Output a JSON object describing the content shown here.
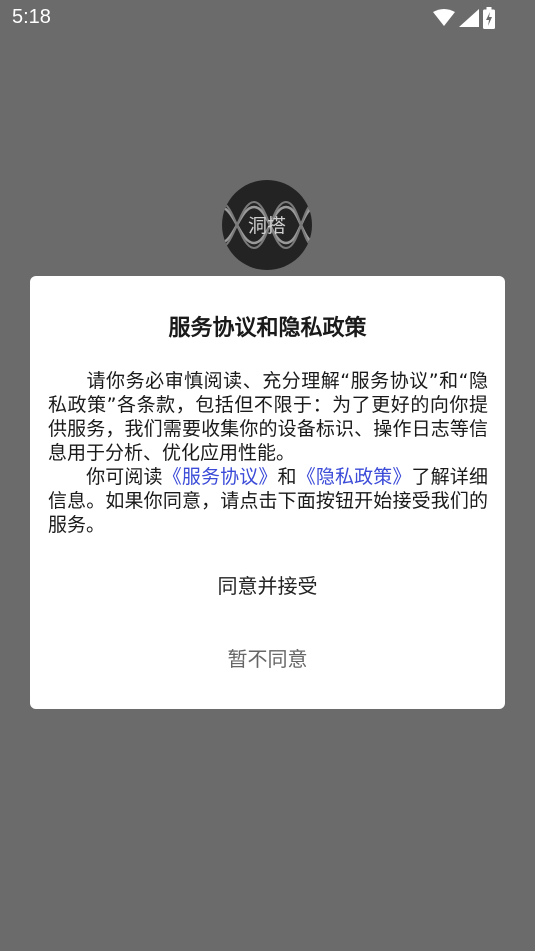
{
  "status_bar": {
    "time": "5:18",
    "icons": [
      "wifi-icon",
      "signal-icon",
      "battery-charging-icon"
    ]
  },
  "logo": {
    "text": "洞搭"
  },
  "dialog": {
    "title": "服务协议和隐私政策",
    "paragraph1": "请你务必审慎阅读、充分理解“服务协议”和“隐私政策”各条款，包括但不限于：为了更好的向你提供服务，我们需要收集你的设备标识、操作日志等信息用于分析、优化应用性能。",
    "paragraph2_prefix": "你可阅读",
    "service_link": "《服务协议》",
    "and_text": "和",
    "privacy_link": "《隐私政策》",
    "paragraph2_suffix": "了解详细信息。如果你同意，请点击下面按钮开始接受我们的服务。",
    "agree_label": "同意并接受",
    "decline_label": "暂不同意",
    "colors": {
      "link": "#3b4bd8",
      "overlay": "#6b6b6b"
    }
  }
}
